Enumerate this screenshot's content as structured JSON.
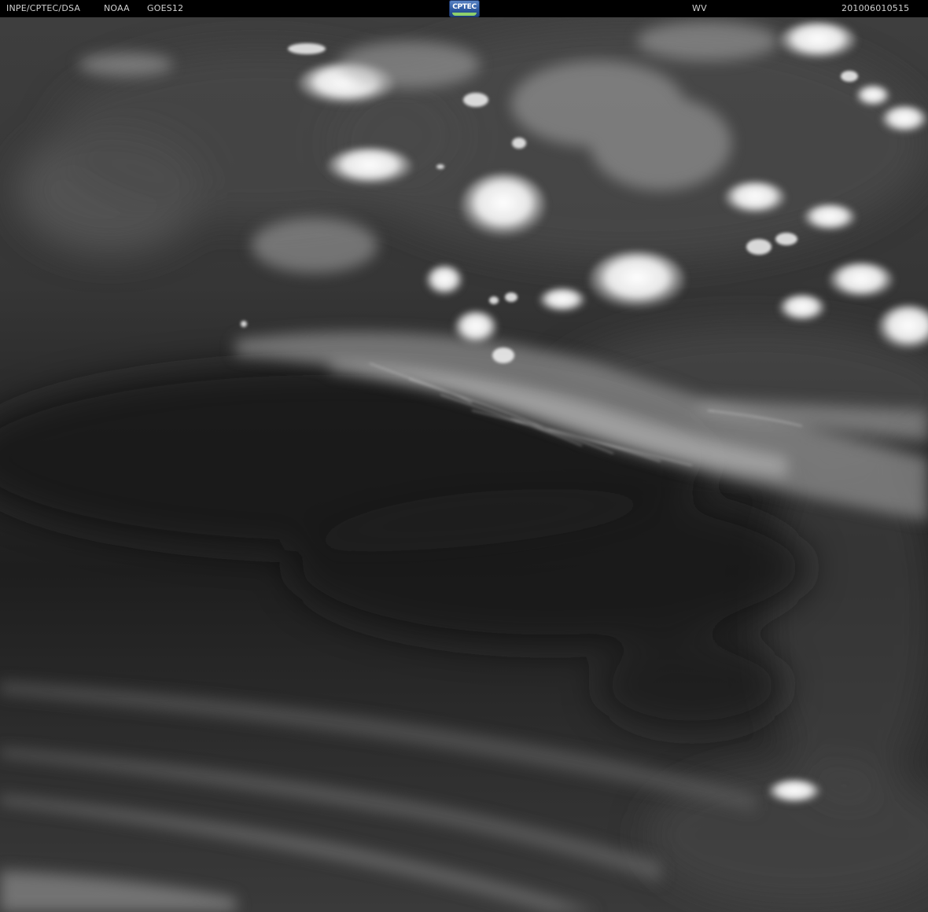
{
  "header": {
    "source": "INPE/CPTEC/DSA",
    "agency": "NOAA",
    "satellite": "GOES12",
    "channel": "WV",
    "timestamp": "201006010515"
  },
  "logo": {
    "text": "CPTEC"
  },
  "image": {
    "description_channel": "water vapor",
    "colors": {
      "background": "#1e1e1e",
      "header_bar": "#000000",
      "header_text": "#d0d0d0",
      "cloud_bright": "#f2f2f2",
      "moist_band": "#8a8a8a",
      "dry_slot": "#1c1c1c"
    }
  }
}
